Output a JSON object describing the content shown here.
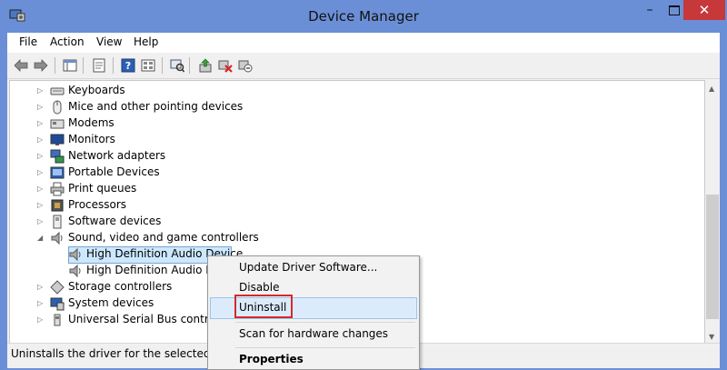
{
  "window": {
    "title": "Device Manager",
    "minimize": "–",
    "close": "✕",
    "titlebar_color": "#6b8fd6",
    "close_color": "#c7383b"
  },
  "menu": [
    "File",
    "Action",
    "View",
    "Help"
  ],
  "toolbar_icons": [
    "back-icon",
    "forward-icon",
    "show-hide-console-tree-icon",
    "properties-icon",
    "help-icon",
    "view-icon",
    "scan-hardware-icon",
    "update-driver-icon",
    "uninstall-icon",
    "disable-icon"
  ],
  "tree": {
    "items": [
      {
        "label": "Keyboards",
        "icon": "keyboard-icon",
        "expanded": false
      },
      {
        "label": "Mice and other pointing devices",
        "icon": "mouse-icon",
        "expanded": false
      },
      {
        "label": "Modems",
        "icon": "modem-icon",
        "expanded": false
      },
      {
        "label": "Monitors",
        "icon": "monitor-icon",
        "expanded": false
      },
      {
        "label": "Network adapters",
        "icon": "network-adapter-icon",
        "expanded": false
      },
      {
        "label": "Portable Devices",
        "icon": "portable-device-icon",
        "expanded": false
      },
      {
        "label": "Print queues",
        "icon": "printer-icon",
        "expanded": false
      },
      {
        "label": "Processors",
        "icon": "processor-icon",
        "expanded": false
      },
      {
        "label": "Software devices",
        "icon": "software-device-icon",
        "expanded": false
      },
      {
        "label": "Sound, video and game controllers",
        "icon": "speaker-icon",
        "expanded": true
      },
      {
        "label": "High Definition Audio Device",
        "icon": "speaker-icon",
        "child": true,
        "selected": true
      },
      {
        "label": "High Definition Audio Device",
        "icon": "speaker-icon",
        "child": true
      },
      {
        "label": "Storage controllers",
        "icon": "storage-controller-icon",
        "expanded": false
      },
      {
        "label": "System devices",
        "icon": "system-device-icon",
        "expanded": false
      },
      {
        "label": "Universal Serial Bus controllers",
        "icon": "usb-icon",
        "expanded": false
      }
    ]
  },
  "status": "Uninstalls the driver for the selected device.",
  "context_menu": {
    "update": "Update Driver Software...",
    "disable": "Disable",
    "uninstall": "Uninstall",
    "scan": "Scan for hardware changes",
    "properties": "Properties",
    "highlight_color": "#dcebfc",
    "callout_color": "#d42a2a"
  }
}
